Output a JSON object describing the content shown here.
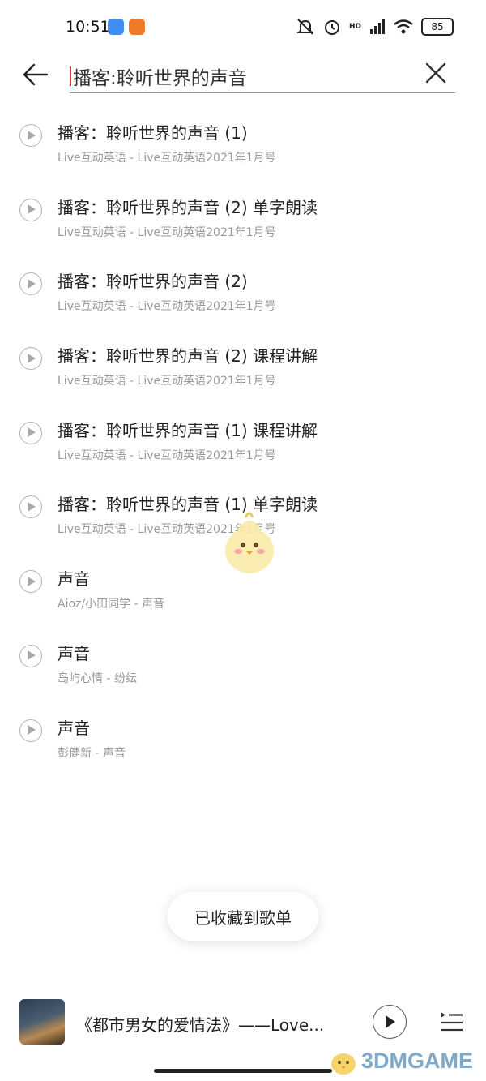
{
  "status": {
    "time": "10:51",
    "network_label": "HD",
    "battery": "85"
  },
  "search": {
    "query": "播客:聆听世界的声音"
  },
  "results": [
    {
      "title": "播客：聆听世界的声音 (1)",
      "subtitle": "Live互动英语 - Live互动英语2021年1月号"
    },
    {
      "title": "播客：聆听世界的声音 (2) 单字朗读",
      "subtitle": "Live互动英语 - Live互动英语2021年1月号"
    },
    {
      "title": "播客：聆听世界的声音 (2)",
      "subtitle": "Live互动英语 - Live互动英语2021年1月号"
    },
    {
      "title": "播客：聆听世界的声音 (2) 课程讲解",
      "subtitle": "Live互动英语 - Live互动英语2021年1月号"
    },
    {
      "title": "播客：聆听世界的声音 (1) 课程讲解",
      "subtitle": "Live互动英语 - Live互动英语2021年1月号"
    },
    {
      "title": "播客：聆听世界的声音 (1) 单字朗读",
      "subtitle": "Live互动英语 - Live互动英语2021年1月号"
    },
    {
      "title": "声音",
      "subtitle": "Aioz/小田同学 - 声音"
    },
    {
      "title": "声音",
      "subtitle": "岛屿心情 - 纷纭"
    },
    {
      "title": "声音",
      "subtitle": "彭健新 - 声音"
    }
  ],
  "toast": {
    "message": "已收藏到歌单"
  },
  "now_playing": {
    "title": "《都市男女的爱情法》——Love..."
  },
  "watermark": {
    "text": "3DMGAME"
  },
  "icons": {
    "back": "arrow-left-icon",
    "clear": "close-icon",
    "play": "play-circle-icon",
    "playlist": "playlist-icon"
  }
}
